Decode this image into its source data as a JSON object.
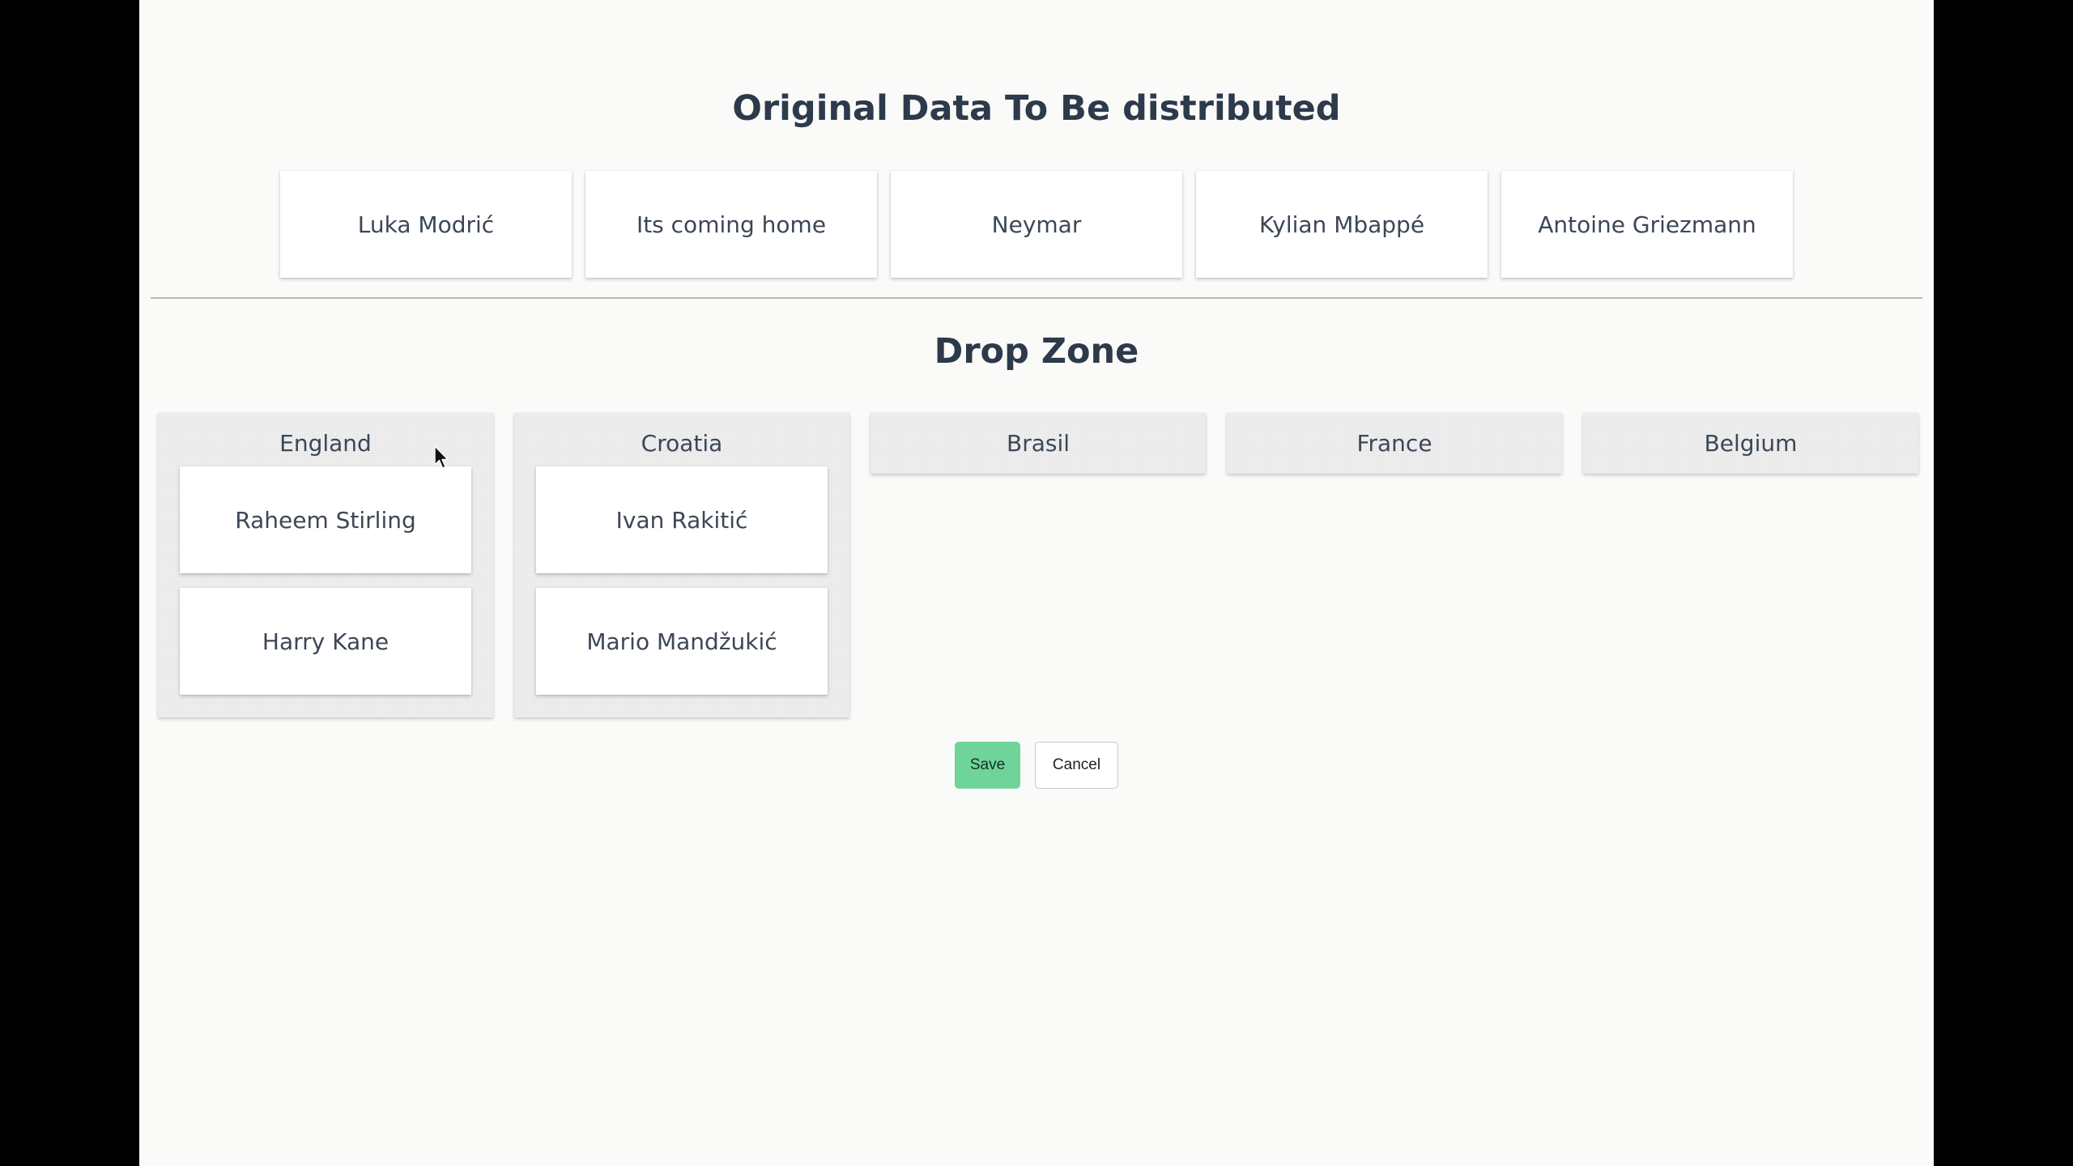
{
  "headings": {
    "original": "Original Data To Be distributed",
    "drop_zone": "Drop Zone"
  },
  "source_items": [
    "Luka Modrić",
    "Its coming home",
    "Neymar",
    "Kylian Mbappé",
    "Antoine Griezmann"
  ],
  "zones": [
    {
      "label": "England",
      "items": [
        "Raheem Stirling",
        "Harry Kane"
      ]
    },
    {
      "label": "Croatia",
      "items": [
        "Ivan Rakitić",
        "Mario Mandžukić"
      ]
    },
    {
      "label": "Brasil",
      "items": []
    },
    {
      "label": "France",
      "items": []
    },
    {
      "label": "Belgium",
      "items": []
    }
  ],
  "buttons": {
    "save": "Save",
    "cancel": "Cancel"
  },
  "colors": {
    "save_bg": "#6fd49a",
    "heading": "#2c3a4b",
    "divider": "#b9b8a4"
  }
}
